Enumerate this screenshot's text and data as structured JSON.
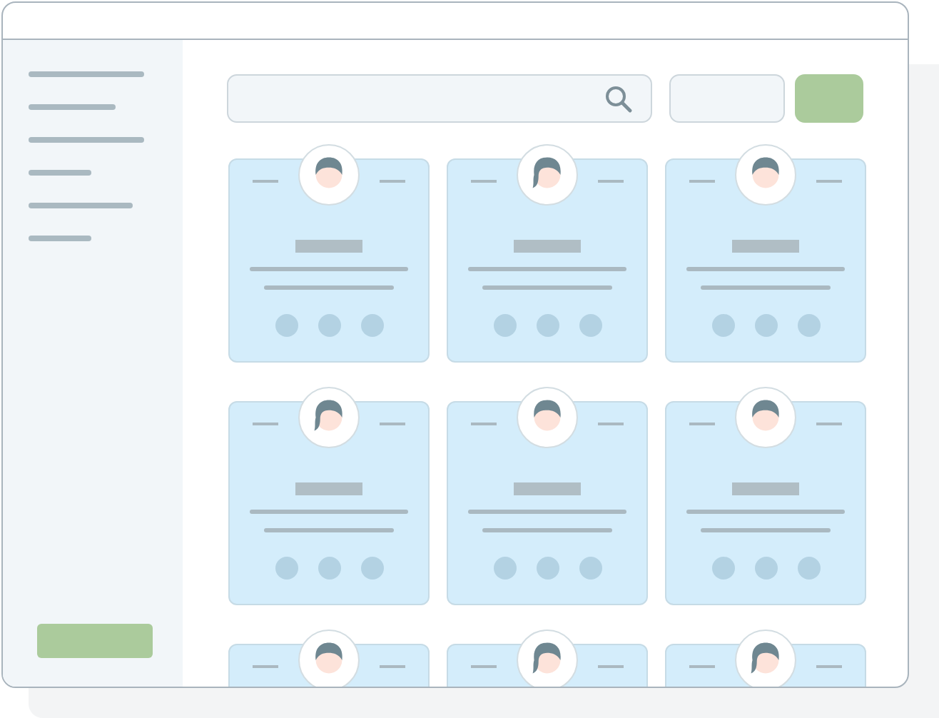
{
  "sidebar": {
    "items": [
      {
        "kind": "long"
      },
      {
        "kind": "short"
      },
      {
        "kind": "long"
      },
      {
        "kind": "tiny"
      },
      {
        "kind": "medium"
      },
      {
        "kind": "tiny"
      }
    ],
    "button": {
      "kind": "filled"
    }
  },
  "toolbar": {
    "search": {
      "kind": "search"
    },
    "buttons": [
      {
        "kind": "outline"
      },
      {
        "kind": "filled"
      }
    ]
  },
  "cards": [
    {
      "avatar": {
        "kind": "short-hair"
      }
    },
    {
      "avatar": {
        "kind": "long-hair"
      }
    },
    {
      "avatar": {
        "kind": "short-hair"
      }
    },
    {
      "avatar": {
        "kind": "long-hair"
      }
    },
    {
      "avatar": {
        "kind": "short-hair"
      }
    },
    {
      "avatar": {
        "kind": "short-hair"
      }
    },
    {
      "avatar": {
        "kind": "short-hair"
      }
    },
    {
      "avatar": {
        "kind": "long-hair"
      }
    },
    {
      "avatar": {
        "kind": "long-hair"
      }
    }
  ]
}
